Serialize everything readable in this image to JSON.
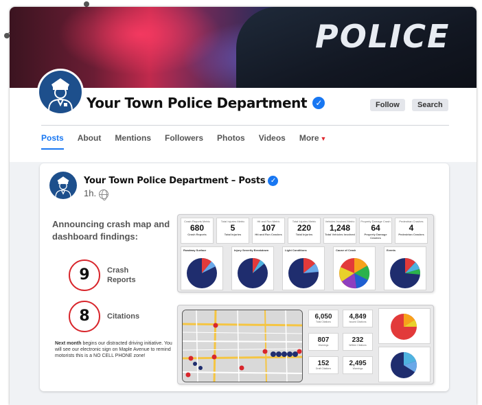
{
  "cover": {
    "banner_text": "POLICE"
  },
  "page": {
    "name": "Your Town Police Department",
    "verified_mark": "✓",
    "buttons": {
      "follow": "Follow",
      "search": "Search"
    }
  },
  "tabs": [
    {
      "label": "Posts",
      "active": true
    },
    {
      "label": "About"
    },
    {
      "label": "Mentions"
    },
    {
      "label": "Followers"
    },
    {
      "label": "Photos"
    },
    {
      "label": "Videos"
    },
    {
      "label": "More",
      "caret": "▼"
    }
  ],
  "post": {
    "title": "Your Town Police Department – Posts",
    "time": "1h.",
    "announcement": "Announcing crash map and dashboard findings:",
    "stats": [
      {
        "value": "9",
        "label": "Crash Reports"
      },
      {
        "value": "8",
        "label": "Citations"
      }
    ],
    "footnote_lead": "Next month",
    "footnote_rest": " begins our distracted driving initiative. You will see our electronic sign on Maple Avenue to remind motorists this is a NO CELL PHONE zone!"
  },
  "dashboard1": {
    "kpis": [
      {
        "title": "Crash Reports Metric",
        "value": "680",
        "sub": "Crash Reports"
      },
      {
        "title": "Total Injuries Metric",
        "value": "5",
        "sub": "Total Injuries"
      },
      {
        "title": "Hit and Run Metric",
        "value": "107",
        "sub": "Hit and Run Crashes"
      },
      {
        "title": "Total Injuries Metric",
        "value": "220",
        "sub": "Total Injuries"
      },
      {
        "title": "Vehicles Involved Metric",
        "value": "1,248",
        "sub": "Total Vehicles Involved"
      },
      {
        "title": "Property Damage Crash Metric",
        "value": "64",
        "sub": "Property Damage Crashes"
      },
      {
        "title": "Pedestrian Crashes Metric",
        "value": "4",
        "sub": "Pedestrian Crashes"
      }
    ],
    "pies": [
      {
        "title": "Roadway Surface Conditions"
      },
      {
        "title": "Injury Severity Breakdown"
      },
      {
        "title": "Light Conditions"
      },
      {
        "title": "Cause of Crash"
      },
      {
        "title": "Events"
      }
    ]
  },
  "dashboard2": {
    "minis": [
      {
        "value": "6,050",
        "sub": "Total Citations"
      },
      {
        "value": "4,849",
        "sub": "Issued Citations"
      },
      {
        "value": "807",
        "sub": "Warnings"
      },
      {
        "value": "232",
        "sub": "Written Citations"
      },
      {
        "value": "152",
        "sub": "Draft Citations"
      },
      {
        "value": "2,495",
        "sub": "Warnings"
      }
    ]
  },
  "colors": {
    "brand_blue": "#1877f2",
    "badge_navy": "#1d4f8c",
    "accent_red": "#d8262c",
    "page_bg": "#f0f2f5"
  }
}
